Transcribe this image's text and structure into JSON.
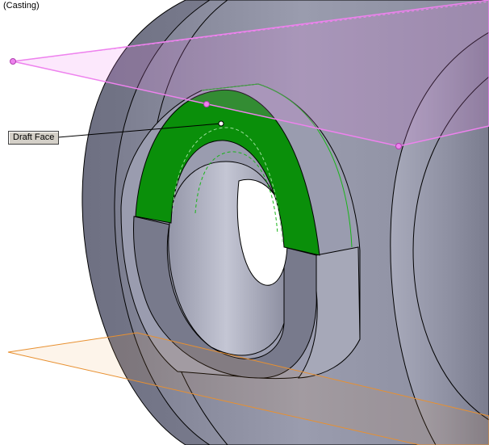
{
  "viewport": {
    "title": "(Casting)"
  },
  "callout": {
    "label": "Draft Face"
  },
  "colors": {
    "body": "#8c8ea0",
    "body_light": "#b2b4c4",
    "body_dark": "#6c6e80",
    "selected_face": "#0a8f0a",
    "plane_pink": "#ee82ee",
    "plane_orange": "#e89030",
    "background": "#ffffff"
  }
}
